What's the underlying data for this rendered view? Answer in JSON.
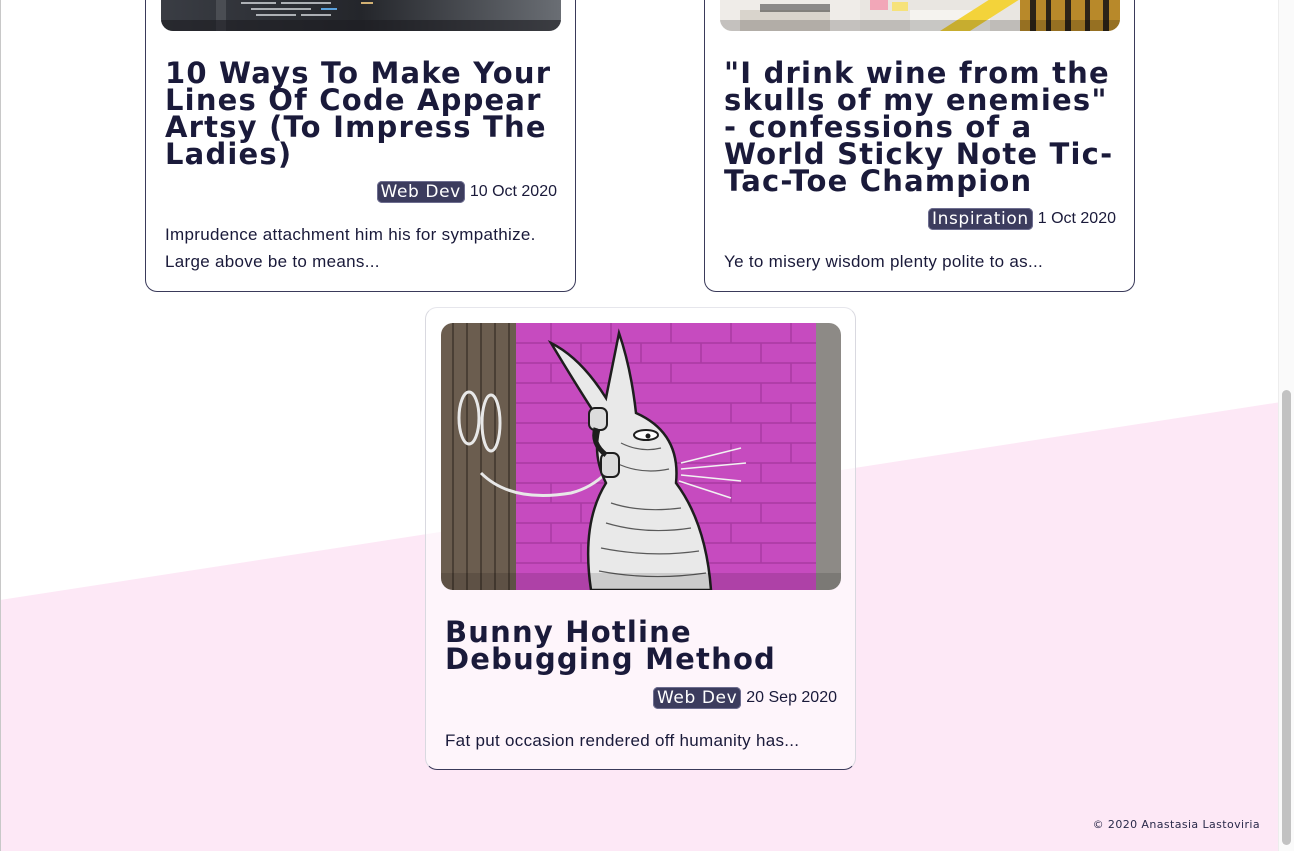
{
  "theme": {
    "background_pink": "#fde8f6",
    "card_border": "#3a3a5a",
    "tag_bg": "#3c3c5e",
    "text_color": "#1a1a3a"
  },
  "posts": [
    {
      "title": "10 Ways To Make Your Lines Of Code Appear Artsy (To Impress The Ladies)",
      "tag": "Web Dev",
      "date": "10 Oct 2020",
      "excerpt": "Imprudence attachment him his for sympathize. Large above be to means...",
      "image": "code-on-screen-photo"
    },
    {
      "title": "\"I drink wine from the skulls of my enemies\" - confessions of a World Sticky Note Tic-Tac-Toe Champion",
      "tag": "Inspiration",
      "date": "1 Oct 2020",
      "excerpt": "Ye to misery wisdom plenty polite to as...",
      "image": "desk-with-sticky-notes-photo"
    },
    {
      "title": "Bunny Hotline Debugging Method",
      "tag": "Web Dev",
      "date": "20 Sep 2020",
      "excerpt": "Fat put occasion rendered off humanity has...",
      "image": "bunny-graffiti-pink-brick-wall-photo"
    }
  ],
  "footer": {
    "copyright": "© 2020 Anastasia Lastoviria"
  }
}
